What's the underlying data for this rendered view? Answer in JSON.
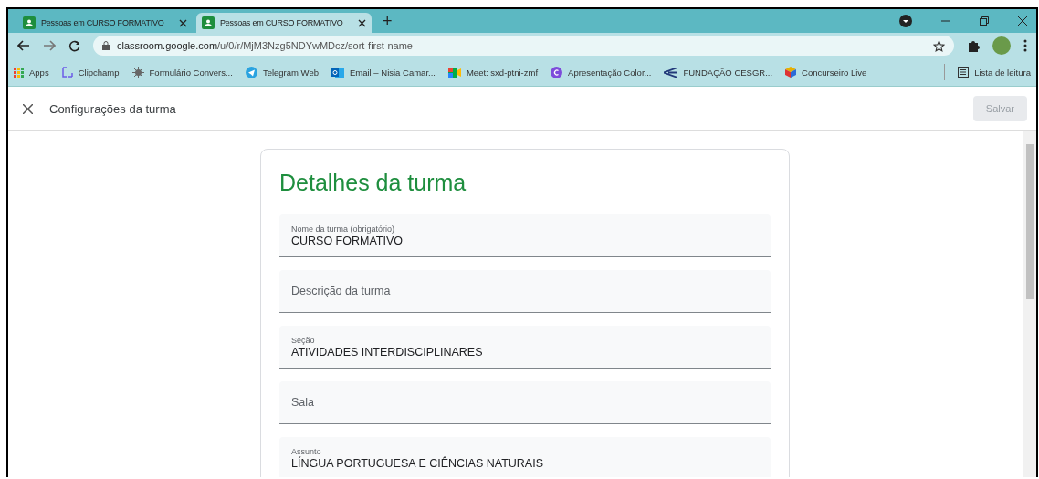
{
  "tabs": [
    {
      "label": "Pessoas em CURSO FORMATIVO",
      "selected": false
    },
    {
      "label": "Pessoas em CURSO FORMATIVO",
      "selected": true
    }
  ],
  "new_tab": "+",
  "address": {
    "host": "classroom.google.com",
    "path": "/u/0/r/MjM3Nzg5NDYwMDcz/sort-first-name"
  },
  "bookmarks": [
    {
      "label": "Apps",
      "kind": "apps"
    },
    {
      "label": "Clipchamp",
      "kind": "clip"
    },
    {
      "label": "Formulário Convers...",
      "kind": "bug"
    },
    {
      "label": "Telegram Web",
      "kind": "telegram"
    },
    {
      "label": "Email – Nisia Camar...",
      "kind": "outlook"
    },
    {
      "label": "Meet: sxd-ptni-zmf",
      "kind": "meet"
    },
    {
      "label": "Apresentação Color...",
      "kind": "canva"
    },
    {
      "label": "FUNDAÇÃO CESGR...",
      "kind": "arrow"
    },
    {
      "label": "Concurseiro Live",
      "kind": "cube"
    }
  ],
  "reading_list": "Lista de leitura",
  "app_bar": {
    "title": "Configurações da turma",
    "save": "Salvar",
    "save_disabled": true
  },
  "card": {
    "title": "Detalhes da turma",
    "fields": [
      {
        "label": "Nome da turma (obrigatório)",
        "value": "CURSO FORMATIVO"
      },
      {
        "placeholder": "Descrição da turma"
      },
      {
        "label": "Seção",
        "value": "ATIVIDADES INTERDISCIPLINARES"
      },
      {
        "placeholder": "Sala"
      },
      {
        "label": "Assunto",
        "value": "LÍNGUA PORTUGUESA E CIÊNCIAS NATURAIS"
      }
    ]
  }
}
